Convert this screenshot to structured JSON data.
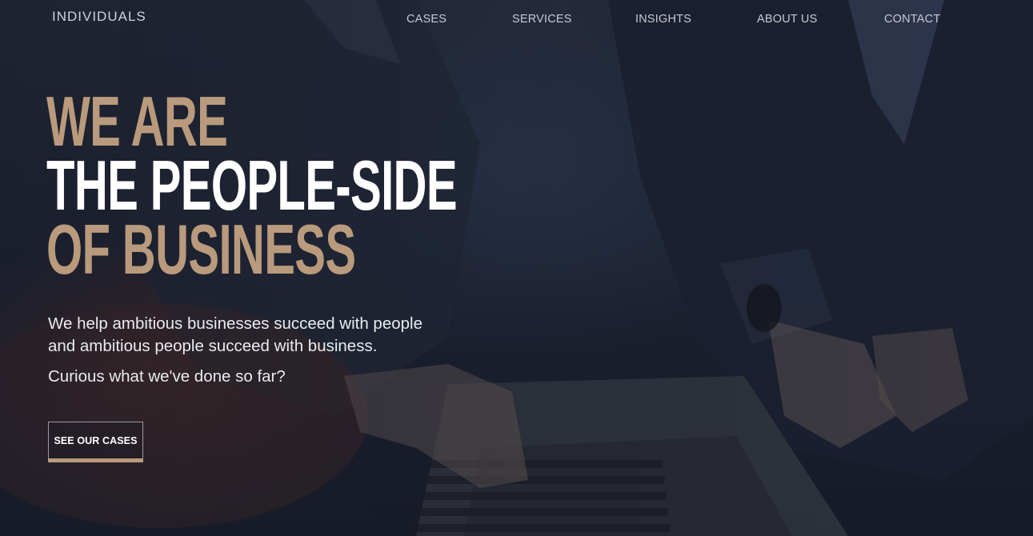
{
  "header": {
    "logo_text": "INDIVIDUALS",
    "nav": [
      {
        "label": "CASES"
      },
      {
        "label": "SERVICES"
      },
      {
        "label": "INSIGHTS"
      },
      {
        "label": "ABOUT US"
      },
      {
        "label": "CONTACT"
      }
    ]
  },
  "hero": {
    "headline": {
      "line1": "WE ARE",
      "line2": "THE PEOPLE-SIDE",
      "line3": "OF BUSINESS"
    },
    "body_line1": "We help ambitious businesses succeed with people",
    "body_line2": "and ambitious people succeed with business.",
    "question": "Curious what we've done so far?",
    "cta_label": "SEE OUR CASES"
  },
  "colors": {
    "accent_tan": "#b99a7c",
    "headline_white": "#ffffff",
    "background_navy": "#1d2231"
  }
}
